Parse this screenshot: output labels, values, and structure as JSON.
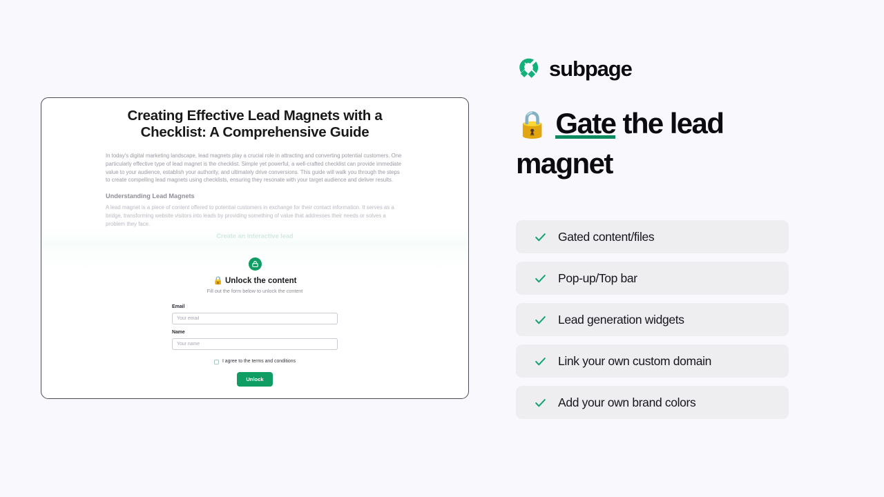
{
  "brand": {
    "name": "subpage",
    "logo_icon": "magnet-icon",
    "accent_color": "#0f9d63"
  },
  "headline": {
    "emoji": "🔒",
    "underlined_word": "Gate",
    "rest": " the lead magnet",
    "underline_color": "#0e8a5f"
  },
  "features": [
    {
      "label": "Gated content/files",
      "icon": "check-icon"
    },
    {
      "label": "Pop-up/Top bar",
      "icon": "check-icon"
    },
    {
      "label": "Lead generation widgets",
      "icon": "check-icon"
    },
    {
      "label": "Link your own custom domain",
      "icon": "check-icon"
    },
    {
      "label": "Add your own brand colors",
      "icon": "check-icon"
    }
  ],
  "preview": {
    "article": {
      "title": "Creating Effective Lead Magnets with a Checklist: A Comprehensive Guide",
      "paragraph": "In today's digital marketing landscape, lead magnets play a crucial role in attracting and converting potential customers. One particularly effective type of lead magnet is the checklist. Simple yet powerful, a well-crafted checklist can provide immediate value to your audience, establish your authority, and ultimately drive conversions. This guide will walk you through the steps to create compelling lead magnets using checklists, ensuring they resonate with your target audience and deliver results.",
      "subheading": "Understanding Lead Magnets",
      "paragraph2": "A lead magnet is a piece of content offered to potential customers in exchange for their contact information. It serves as a bridge, transforming website visitors into leads by providing something of value that addresses their needs or solves a problem they face.",
      "faded_text": "Create an interactive lead"
    },
    "gate": {
      "badge_icon": "lock-icon",
      "title_emoji": "🔒",
      "title": "Unlock the content",
      "subtitle": "Fill out the form below to unlock the content",
      "fields": [
        {
          "label": "Email",
          "placeholder": "Your email",
          "value": ""
        },
        {
          "label": "Name",
          "placeholder": "Your name",
          "value": ""
        }
      ],
      "terms_label": "I agree to the terms and conditions",
      "terms_checked": false,
      "submit_label": "Unlock"
    }
  }
}
